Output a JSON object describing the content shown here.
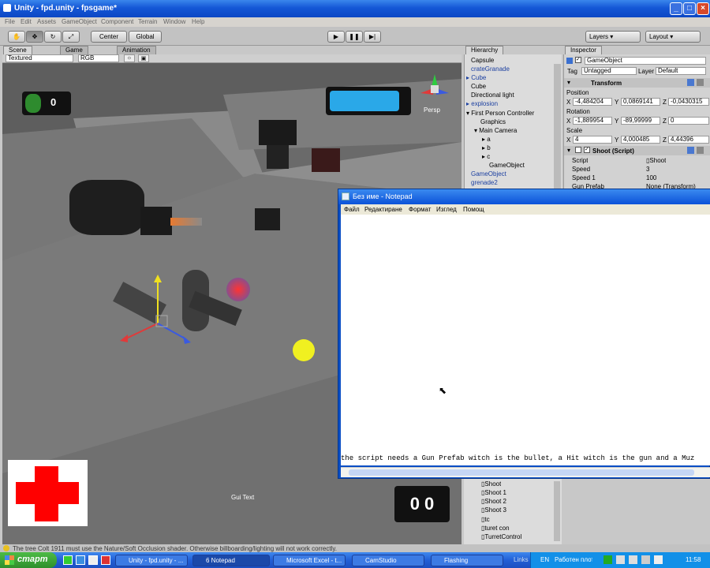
{
  "window": {
    "title": "Unity - fpd.unity - fpsgame*"
  },
  "menu": [
    "File",
    "Edit",
    "Assets",
    "GameObject",
    "Component",
    "Terrain",
    "Window",
    "Help"
  ],
  "toolbar": {
    "pivot": "Center",
    "space": "Global",
    "layers": "Layers",
    "layout": "Layout"
  },
  "tabs": {
    "scene": "Scene",
    "game": "Game",
    "animation": "Animation",
    "hierarchy": "Hierarchy",
    "inspector": "Inspector"
  },
  "scene": {
    "draw_mode": "Textured",
    "render_mode": "RGB",
    "persp": "Persp",
    "grenade_count": "0",
    "ammo": "0 0",
    "gui_text": "Gui Text",
    "health_color": "#ff0000",
    "bar_color": "#2aa8e8"
  },
  "hierarchy": [
    "Capsule",
    "crateGranade",
    "Cube",
    "Cube",
    "Directional light",
    "explosion",
    "First Person Controller",
    "Graphics",
    "Main Camera",
    "a",
    "b",
    "c",
    "GameObject",
    "GameObject",
    "grenade2"
  ],
  "inspector": {
    "object_name": "GameObject",
    "tag_label": "Tag",
    "tag": "Untagged",
    "layer_label": "Layer",
    "layer": "Default",
    "transform": "Transform",
    "position_label": "Position",
    "position": {
      "x": "-4,484204",
      "y": "0,0869141",
      "z": "-0,0430315"
    },
    "rotation_label": "Rotation",
    "rotation": {
      "x": "-1,889954",
      "y": "-89,99999",
      "z": "0"
    },
    "scale_label": "Scale",
    "scale": {
      "x": "4",
      "y": "4,000485",
      "z": "4,44396"
    },
    "component": "Shoot (Script)",
    "script_label": "Script",
    "script": "Shoot",
    "speed_label": "Speed",
    "speed": "3",
    "speed1_label": "Speed 1",
    "speed1": "100",
    "gunprefab_label": "Gun Prefab",
    "gunprefab": "None (Transform)"
  },
  "notepad": {
    "title": "Без име - Notepad",
    "menu": [
      "Файл",
      "Редактиране",
      "Формат",
      "Изглед",
      "Помощ"
    ],
    "text": "the script needs a Gun Prefab witch is the bullet, a Hit witch is the gun and a Muz"
  },
  "project": [
    "Shoot",
    "Shoot 1",
    "Shoot 2",
    "Shoot 3",
    "tc",
    "turet con",
    "TurretControl"
  ],
  "status": "The tree Colt 1911 must use the Nature/Soft Occlusion shader. Otherwise billboarding/lighting will not work correctly.",
  "taskbar": {
    "start": "старт",
    "tasks": [
      "Unity - fpd.unity - ...",
      "6 Notepad",
      "Microsoft Excel - t...",
      "CamStudio",
      "Flashing"
    ],
    "links": "Links",
    "lang": "EN",
    "tray_label": "Работен плот",
    "clock": "11:58"
  }
}
